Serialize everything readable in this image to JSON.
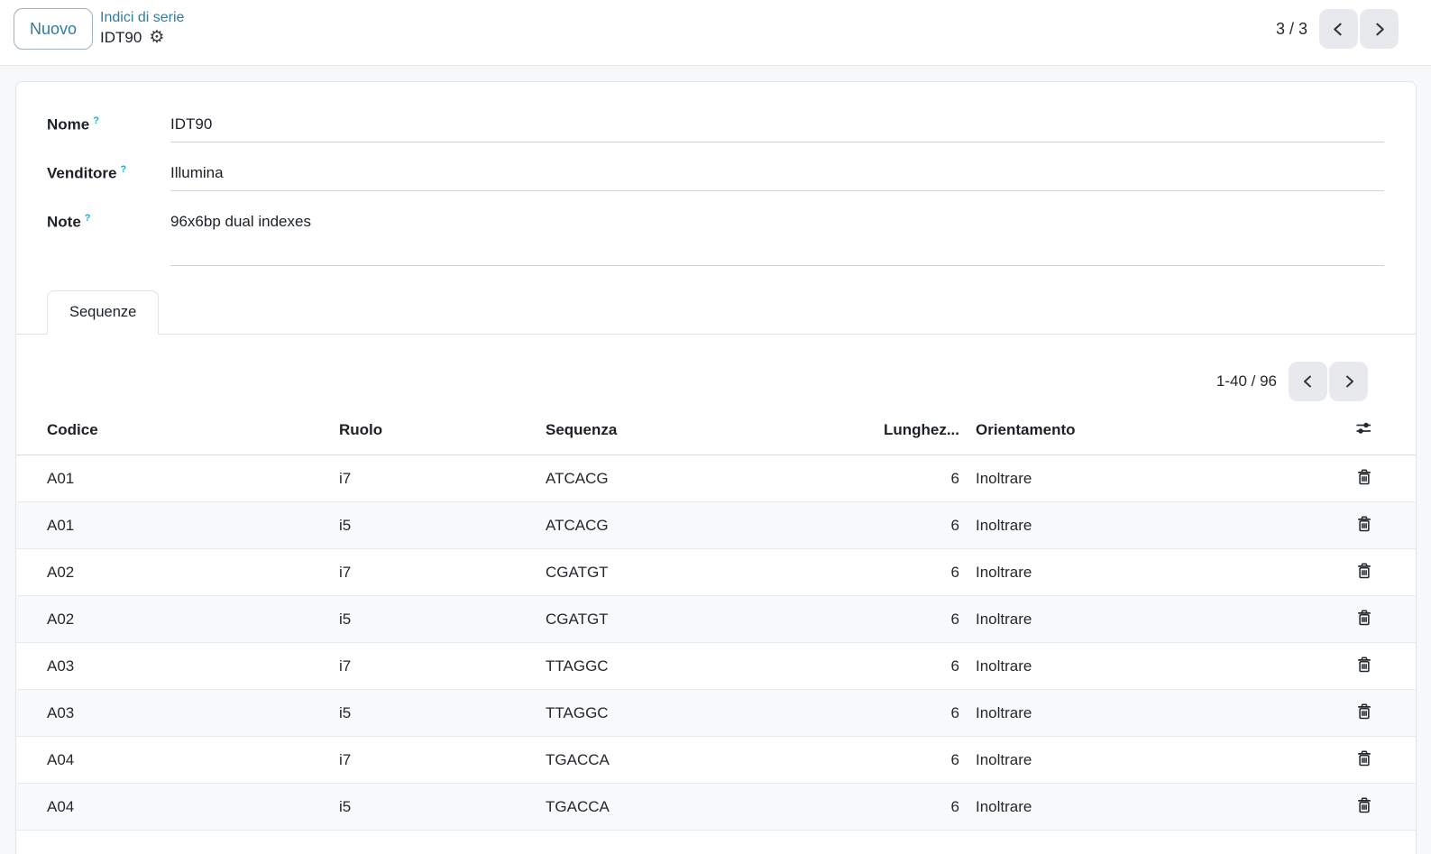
{
  "header": {
    "new_button_label": "Nuovo",
    "breadcrumb_parent": "Indici di serie",
    "record_title": "IDT90",
    "record_pager": "3 / 3"
  },
  "form": {
    "help_indicator": "?",
    "fields": {
      "nome": {
        "label": "Nome",
        "value": "IDT90"
      },
      "venditore": {
        "label": "Venditore",
        "value": "Illumina"
      },
      "note": {
        "label": "Note",
        "value": "96x6bp dual indexes"
      }
    }
  },
  "notebook": {
    "tabs": [
      {
        "label": "Sequenze",
        "active": true
      }
    ]
  },
  "sequence_list": {
    "pager": "1-40 / 96",
    "columns": {
      "codice": "Codice",
      "ruolo": "Ruolo",
      "sequenza": "Sequenza",
      "lunghezza": "Lunghez...",
      "orientamento": "Orientamento"
    },
    "rows": [
      {
        "codice": "A01",
        "ruolo": "i7",
        "sequenza": "ATCACG",
        "lunghezza": "6",
        "orientamento": "Inoltrare"
      },
      {
        "codice": "A01",
        "ruolo": "i5",
        "sequenza": "ATCACG",
        "lunghezza": "6",
        "orientamento": "Inoltrare"
      },
      {
        "codice": "A02",
        "ruolo": "i7",
        "sequenza": "CGATGT",
        "lunghezza": "6",
        "orientamento": "Inoltrare"
      },
      {
        "codice": "A02",
        "ruolo": "i5",
        "sequenza": "CGATGT",
        "lunghezza": "6",
        "orientamento": "Inoltrare"
      },
      {
        "codice": "A03",
        "ruolo": "i7",
        "sequenza": "TTAGGC",
        "lunghezza": "6",
        "orientamento": "Inoltrare"
      },
      {
        "codice": "A03",
        "ruolo": "i5",
        "sequenza": "TTAGGC",
        "lunghezza": "6",
        "orientamento": "Inoltrare"
      },
      {
        "codice": "A04",
        "ruolo": "i7",
        "sequenza": "TGACCA",
        "lunghezza": "6",
        "orientamento": "Inoltrare"
      },
      {
        "codice": "A04",
        "ruolo": "i5",
        "sequenza": "TGACCA",
        "lunghezza": "6",
        "orientamento": "Inoltrare"
      }
    ]
  },
  "icons": {
    "gear": "⚙",
    "chevron_left": "chevron-left",
    "chevron_right": "chevron-right",
    "sliders": "sliders",
    "trash": "trash"
  },
  "colors": {
    "accent_link": "#2e7da5",
    "help_mark": "#2aa8c8",
    "text": "#212529",
    "pager_button_bg": "#e7e9ec",
    "stripe_bg": "#f8f9fa"
  }
}
